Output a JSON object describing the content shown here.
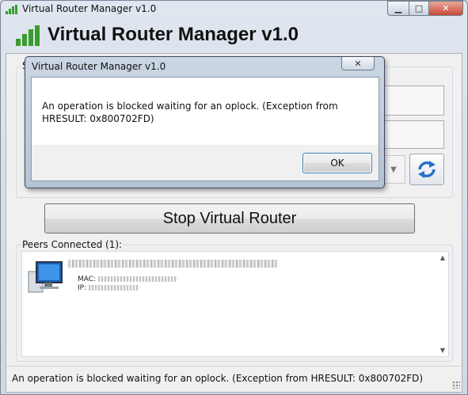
{
  "window": {
    "title": "Virtual Router Manager v1.0",
    "minimize_glyph": "▁",
    "maximize_glyph": "□",
    "close_glyph": "✕"
  },
  "header": {
    "title": "Virtual Router Manager v1.0",
    "icon": "signal-bars-icon"
  },
  "settings": {
    "group_label_visible": "S",
    "refresh_icon": "refresh-icon",
    "combo_glyph": "▼"
  },
  "main": {
    "stop_button_label": "Stop Virtual Router"
  },
  "peers": {
    "label": "Peers Connected (1):",
    "items": [
      {
        "mac_label": "MAC:",
        "ip_label": "IP:"
      }
    ],
    "scroll_up_glyph": "▲",
    "scroll_down_glyph": "▼"
  },
  "status": {
    "text": "An operation is blocked waiting for an oplock. (Exception from HRESULT: 0x800702FD)"
  },
  "dialog": {
    "title": "Virtual Router Manager v1.0",
    "close_glyph": "✕",
    "message": "An operation is blocked waiting for an oplock. (Exception from HRESULT: 0x800702FD)",
    "ok_label": "OK"
  },
  "colors": {
    "accent_green": "#3a9b2e",
    "ok_border": "#3c7fb1"
  }
}
